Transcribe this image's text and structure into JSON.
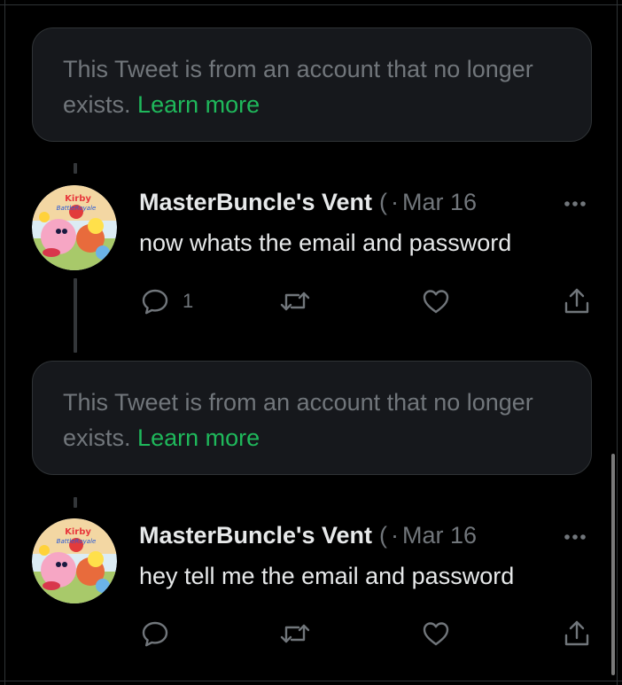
{
  "unavailable_notices": [
    {
      "message": "This Tweet is from an account that no longer exists.",
      "link_label": "Learn more"
    },
    {
      "message": "This Tweet is from an account that no longer exists.",
      "link_label": "Learn more"
    }
  ],
  "tweets": [
    {
      "display_name": "MasterBuncle's Vent",
      "handle_fragment": "(",
      "separator": "·",
      "date": "Mar 16",
      "text": "now whats the email and password",
      "reply_count": "1",
      "avatar_caption": "Kirby Battle Royale"
    },
    {
      "display_name": "MasterBuncle's Vent",
      "handle_fragment": "(",
      "separator": "·",
      "date": "Mar 16",
      "text": "hey tell me the email and password",
      "reply_count": "",
      "avatar_caption": "Kirby Battle Royale"
    }
  ],
  "colors": {
    "background": "#000000",
    "card": "#16181c",
    "muted_text": "#71767b",
    "primary_text": "#e7e9ea",
    "link": "#1fb85b",
    "thread_line": "#333639"
  },
  "icons": [
    "reply-icon",
    "retweet-icon",
    "like-icon",
    "share-icon",
    "more-icon"
  ]
}
